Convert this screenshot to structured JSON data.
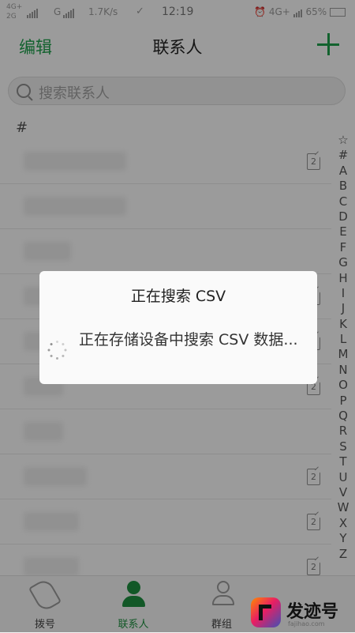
{
  "status_bar": {
    "sim1_net_top": "4G+",
    "sim1_net_bottom": "2G",
    "sim2_net": "G",
    "speed": "1.7K/s",
    "time": "12:19",
    "right_net": "4G+",
    "battery": "65%"
  },
  "header": {
    "edit_label": "编辑",
    "title": "联系人",
    "add_icon": "plus-icon",
    "accent_color": "#1e9e4b"
  },
  "search": {
    "placeholder": "搜索联系人"
  },
  "section_header": "#",
  "rows": [
    {
      "sim_label": "2"
    },
    {
      "sim_label": ""
    },
    {
      "sim_label": ""
    },
    {
      "sim_label": "2"
    },
    {
      "sim_label": "2"
    },
    {
      "sim_label": "2"
    },
    {
      "sim_label": ""
    },
    {
      "sim_label": "2"
    },
    {
      "sim_label": "2"
    },
    {
      "sim_label": "2"
    }
  ],
  "alphabet_index": [
    "☆",
    "#",
    "A",
    "B",
    "C",
    "D",
    "E",
    "F",
    "G",
    "H",
    "I",
    "J",
    "K",
    "L",
    "M",
    "N",
    "O",
    "P",
    "Q",
    "R",
    "S",
    "T",
    "U",
    "V",
    "W",
    "X",
    "Y",
    "Z"
  ],
  "bottom_nav": {
    "tabs": [
      {
        "label": "拨号",
        "icon": "phone-icon",
        "active": false
      },
      {
        "label": "联系人",
        "icon": "contacts-icon",
        "active": true
      },
      {
        "label": "群组",
        "icon": "group-icon",
        "active": false
      }
    ]
  },
  "dialog": {
    "title": "正在搜索 CSV",
    "message": "正在存储设备中搜索 CSV 数据..."
  },
  "watermark": {
    "name": "发迹号",
    "site": "fajihao.com"
  }
}
